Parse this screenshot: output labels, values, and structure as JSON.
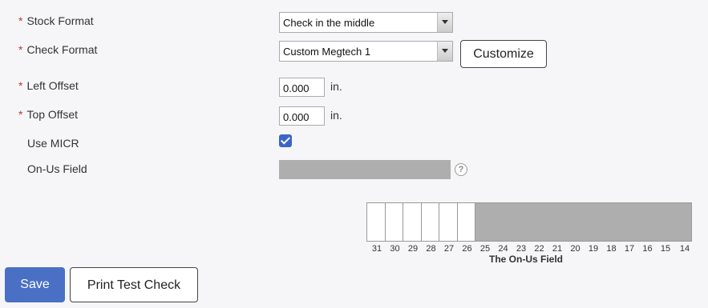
{
  "form": {
    "stock_format": {
      "required_mark": "*",
      "label": "Stock Format",
      "value": "Check in the middle"
    },
    "check_format": {
      "required_mark": "*",
      "label": "Check Format",
      "value": "Custom Megtech 1",
      "customize_label": "Customize"
    },
    "left_offset": {
      "required_mark": "*",
      "label": "Left Offset",
      "value": "0.000",
      "unit": "in."
    },
    "top_offset": {
      "required_mark": "*",
      "label": "Top Offset",
      "value": "0.000",
      "unit": "in."
    },
    "use_micr": {
      "label": "Use MICR",
      "checked": true
    },
    "on_us_field": {
      "label": "On-Us Field",
      "value": "",
      "help": "?"
    }
  },
  "diagram": {
    "positions": [
      "31",
      "30",
      "29",
      "28",
      "27",
      "26",
      "25",
      "24",
      "23",
      "22",
      "21",
      "20",
      "19",
      "18",
      "17",
      "16",
      "15",
      "14"
    ],
    "caption": "The On-Us Field"
  },
  "buttons": {
    "save": "Save",
    "print_test": "Print Test Check"
  },
  "colors": {
    "accent": "#4a70c6",
    "required": "#c0392b",
    "field_fill": "#aeaeae"
  }
}
